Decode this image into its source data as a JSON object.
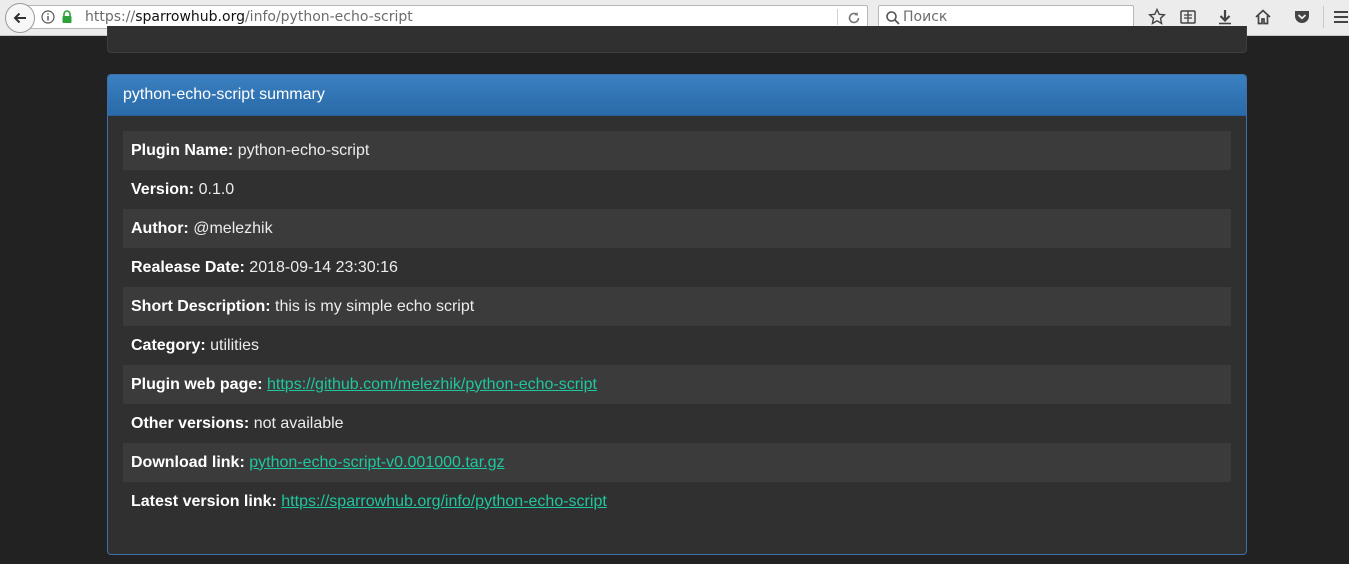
{
  "browser": {
    "url_scheme": "https://",
    "url_host": "sparrowhub.org",
    "url_path": "/info/python-echo-script",
    "search_placeholder": "Поиск"
  },
  "panel": {
    "title": "python-echo-script summary",
    "rows": [
      {
        "label": "Plugin Name:",
        "value": "python-echo-script"
      },
      {
        "label": "Version:",
        "value": "0.1.0"
      },
      {
        "label": "Author:",
        "value": "@melezhik"
      },
      {
        "label": "Realease Date:",
        "value": "2018-09-14 23:30:16"
      },
      {
        "label": "Short Description:",
        "value": "this is my simple echo script"
      },
      {
        "label": "Category:",
        "value": "utilities"
      },
      {
        "label": "Plugin web page:",
        "link": "https://github.com/melezhik/python-echo-script"
      },
      {
        "label": "Other versions:",
        "value": "not available"
      },
      {
        "label": "Download link:",
        "link": "python-echo-script-v0.001000.tar.gz"
      },
      {
        "label": "Latest version link:",
        "link": "https://sparrowhub.org/info/python-echo-script"
      }
    ]
  },
  "colors": {
    "page_bg": "#222222",
    "panel_bg": "#303030",
    "heading_bg": "#2a6aa8",
    "link": "#1fc6a0"
  }
}
